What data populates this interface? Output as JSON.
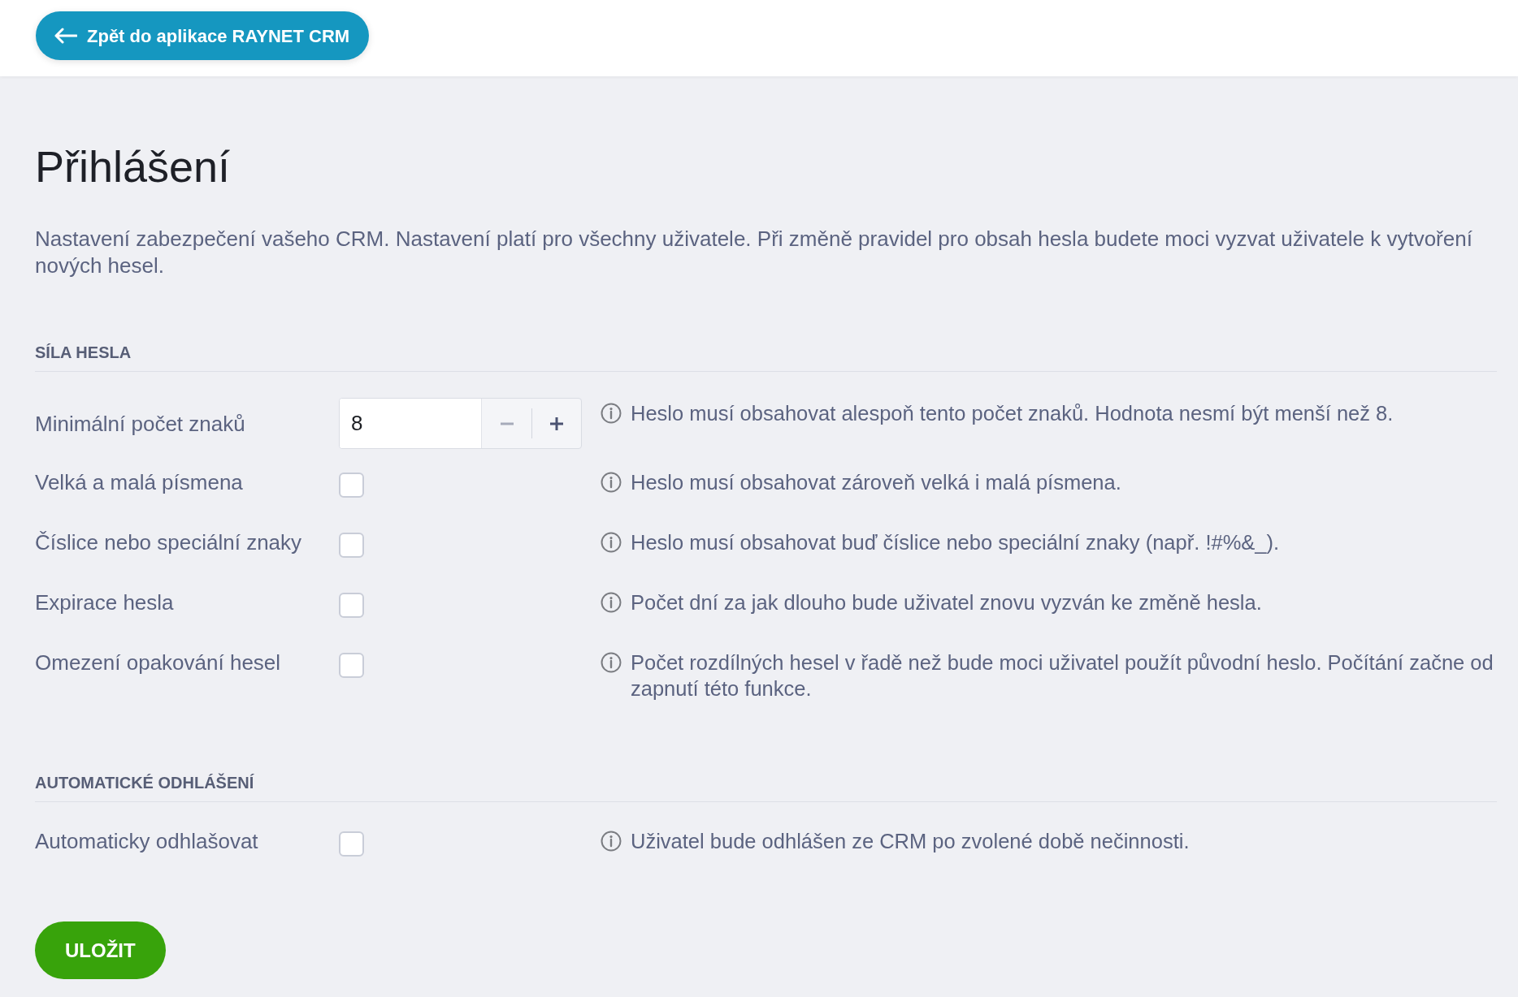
{
  "header": {
    "back_button": {
      "label": "Zpět do aplikace RAYNET CRM"
    }
  },
  "page": {
    "title": "Přihlášení",
    "description": "Nastavení zabezpečení vašeho CRM. Nastavení platí pro všechny uživatele. Při změně pravidel pro obsah hesla budete moci vyzvat uživatele k vytvoření nových hesel."
  },
  "sections": [
    {
      "heading": "SÍLA HESLA",
      "settings": [
        {
          "kind": "stepper",
          "label": "Minimální počet znaků",
          "value": "8",
          "decrement": {
            "disabled": true
          },
          "increment": {
            "disabled": false
          },
          "hint": "Heslo musí obsahovat alespoň tento počet znaků. Hodnota nesmí být menší než 8."
        },
        {
          "kind": "checkbox",
          "label": "Velká a malá písmena",
          "checked": false,
          "hint": "Heslo musí obsahovat zároveň velká i malá písmena."
        },
        {
          "kind": "checkbox",
          "label": "Číslice nebo speciální znaky",
          "checked": false,
          "hint": "Heslo musí obsahovat buď číslice nebo speciální znaky (např. !#%&_)."
        },
        {
          "kind": "checkbox",
          "label": "Expirace hesla",
          "checked": false,
          "hint": "Počet dní za jak dlouho bude uživatel znovu vyzván ke změně hesla."
        },
        {
          "kind": "checkbox",
          "label": "Omezení opakování hesel",
          "checked": false,
          "hint": "Počet rozdílných hesel v řadě než bude moci uživatel použít původní heslo. Počítání začne od zapnutí této funkce."
        }
      ]
    },
    {
      "heading": "AUTOMATICKÉ ODHLÁŠENÍ",
      "settings": [
        {
          "kind": "checkbox",
          "label": "Automaticky odhlašovat",
          "checked": false,
          "hint": "Uživatel bude odhlášen ze CRM po zvolené době nečinnosti."
        }
      ]
    }
  ],
  "save_button": {
    "label": "ULOŽIT"
  }
}
